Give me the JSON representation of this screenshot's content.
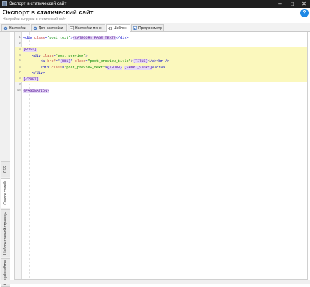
{
  "window": {
    "title": "Экспорт в статический сайт",
    "minimize": "–",
    "maximize": "□",
    "close": "✕"
  },
  "header": {
    "title": "Экспорт в статический сайт",
    "subtitle": "Настройки выгрузки в статический сайт",
    "help": "?"
  },
  "tabs": [
    {
      "label": "Настройки",
      "icon": "gear-icon"
    },
    {
      "label": "Доп. настройки",
      "icon": "gear-icon"
    },
    {
      "label": "Настройки меню",
      "icon": "menu-icon"
    },
    {
      "label": "Шаблон",
      "icon": "code-icon",
      "active": true
    },
    {
      "label": "Предпросмотр",
      "icon": "image-icon"
    }
  ],
  "side_tabs": [
    {
      "label": "CSS"
    },
    {
      "label": "Список статей",
      "active": true
    },
    {
      "label": "Шаблон главной страницы"
    },
    {
      "label": "Общий шаблон"
    }
  ],
  "editor": {
    "lines": [
      {
        "n": "1",
        "tokens": [
          [
            "t",
            "<div "
          ],
          [
            "a",
            "class"
          ],
          [
            "t",
            "="
          ],
          [
            "s",
            "\"post_text\""
          ],
          [
            "t",
            ">"
          ],
          [
            "p",
            "{CATEGORY_PAGE_TEXT}"
          ],
          [
            "t",
            "</div>"
          ]
        ]
      },
      {
        "n": "2",
        "tokens": []
      },
      {
        "n": "3",
        "tokens": [
          [
            "p",
            "[POST]"
          ]
        ],
        "hl": true
      },
      {
        "n": "4",
        "tokens": [
          [
            "t",
            "    <div "
          ],
          [
            "a",
            "class"
          ],
          [
            "t",
            "="
          ],
          [
            "s",
            "\"post_preview\""
          ],
          [
            "t",
            ">"
          ]
        ],
        "hl": true
      },
      {
        "n": "5",
        "tokens": [
          [
            "t",
            "        <a "
          ],
          [
            "a",
            "href"
          ],
          [
            "t",
            "=\""
          ],
          [
            "p",
            "{URL}"
          ],
          [
            "t",
            "\" "
          ],
          [
            "a",
            "class"
          ],
          [
            "t",
            "="
          ],
          [
            "s",
            "\"post_preview_title\""
          ],
          [
            "t",
            ">"
          ],
          [
            "p",
            "{TITLE}"
          ],
          [
            "t",
            "</a><br />"
          ]
        ],
        "hl": true
      },
      {
        "n": "6",
        "tokens": [
          [
            "t",
            "        <div "
          ],
          [
            "a",
            "class"
          ],
          [
            "t",
            "="
          ],
          [
            "s",
            "\"post_preview_text\""
          ],
          [
            "t",
            ">"
          ],
          [
            "p",
            "{THUMB}"
          ],
          [
            "t",
            " "
          ],
          [
            "p",
            "{SHORT_STORY}"
          ],
          [
            "t",
            "</div>"
          ]
        ],
        "hl": true
      },
      {
        "n": "7",
        "tokens": [
          [
            "t",
            "    </div>"
          ]
        ],
        "hl": true
      },
      {
        "n": "8",
        "tokens": [
          [
            "p",
            "[/POST]"
          ]
        ],
        "hl": true
      },
      {
        "n": "9",
        "tokens": []
      },
      {
        "n": "10",
        "tokens": [
          [
            "p",
            "{PAGINATION}"
          ]
        ]
      }
    ]
  },
  "colors": {
    "tag": "#0000cc",
    "attribute": "#c04040",
    "string": "#008800",
    "placeholder": "#5a189a",
    "highlight": "#fbf8bd"
  }
}
